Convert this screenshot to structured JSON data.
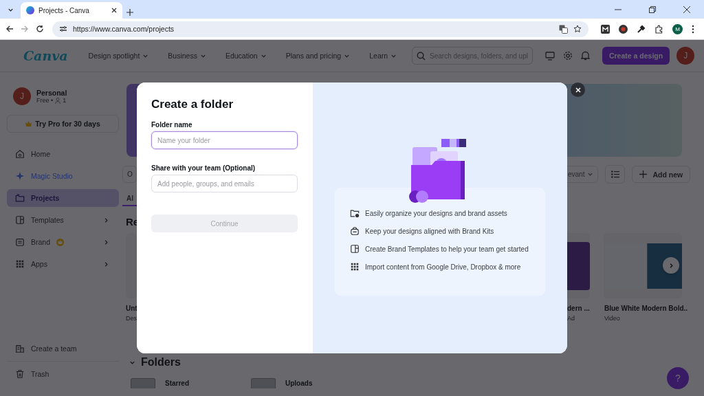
{
  "browser": {
    "tab_title": "Projects - Canva",
    "url": "https://www.canva.com/projects",
    "profile_initial": "M"
  },
  "header": {
    "logo": "Canva",
    "nav": [
      {
        "label": "Design spotlight"
      },
      {
        "label": "Business"
      },
      {
        "label": "Education"
      },
      {
        "label": "Plans and pricing"
      },
      {
        "label": "Learn"
      }
    ],
    "search": {
      "placeholder": "Search designs, folders, and upl"
    },
    "create_button": "Create a design",
    "avatar": "J"
  },
  "sidebar": {
    "account": {
      "avatar": "J",
      "name": "Personal",
      "plan": "Free •",
      "members": "1"
    },
    "trial_button": "Try Pro for 30 days",
    "items": [
      {
        "label": "Home",
        "selected": false,
        "expandable": false,
        "pro_badge": false
      },
      {
        "label": "Magic Studio",
        "selected": false,
        "expandable": false,
        "pro_badge": false
      },
      {
        "label": "Projects",
        "selected": true,
        "expandable": false,
        "pro_badge": false
      },
      {
        "label": "Templates",
        "selected": false,
        "expandable": true,
        "pro_badge": false
      },
      {
        "label": "Brand",
        "selected": false,
        "expandable": true,
        "pro_badge": true
      },
      {
        "label": "Apps",
        "selected": false,
        "expandable": true,
        "pro_badge": false
      }
    ],
    "footer_items": [
      {
        "label": "Create a team"
      },
      {
        "label": "Trash"
      }
    ]
  },
  "main": {
    "filter_button": "O",
    "sort_dropdown": "evant",
    "add_button": "Add new",
    "tab": "Al",
    "recent_heading": "Re",
    "designs": [
      {
        "title": "Unt",
        "type": "Des"
      },
      {
        "title": "dern ...",
        "type": "Ad"
      },
      {
        "title": "Blue White Modern Bold..",
        "type": "Video"
      }
    ],
    "folders_heading": "Folders",
    "folders": [
      {
        "name": "Starred"
      },
      {
        "name": "Uploads"
      }
    ],
    "help_button": "?"
  },
  "dialog": {
    "title": "Create a folder",
    "fields": [
      {
        "label": "Folder name",
        "placeholder": "Name your folder",
        "focused": true
      },
      {
        "label": "Share with your team (Optional)",
        "placeholder": "Add people, groups, and emails",
        "focused": false
      }
    ],
    "continue_button": {
      "label": "Continue",
      "disabled": true
    },
    "features": [
      {
        "text": "Easily organize your designs and brand assets"
      },
      {
        "text": "Keep your designs aligned with Brand Kits"
      },
      {
        "text": "Create Brand Templates to help your team get started"
      },
      {
        "text": "Import content from Google Drive, Dropbox & more"
      }
    ]
  }
}
